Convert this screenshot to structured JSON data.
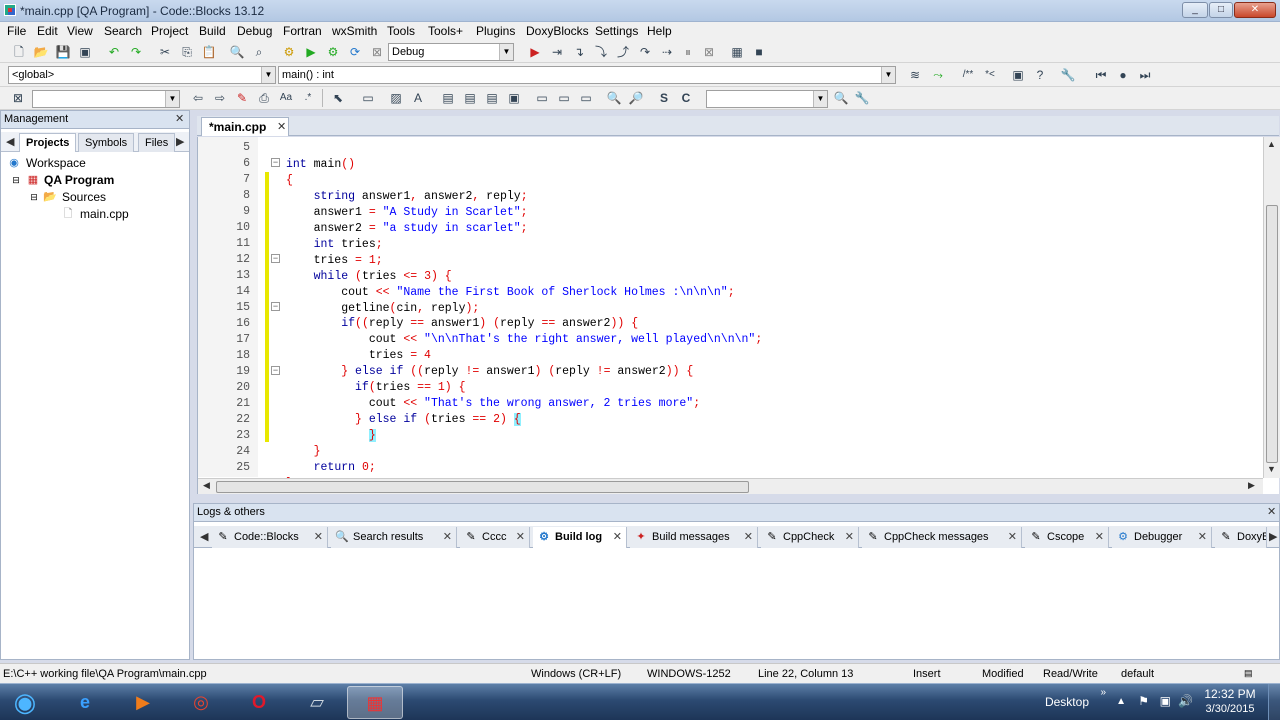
{
  "window": {
    "title": "*main.cpp [QA Program] - Code::Blocks 13.12",
    "controls": [
      "_",
      "□",
      "✕"
    ]
  },
  "menu": [
    "File",
    "Edit",
    "View",
    "Search",
    "Project",
    "Build",
    "Debug",
    "Fortran",
    "wxSmith",
    "Tools",
    "Tools+",
    "Plugins",
    "DoxyBlocks",
    "Settings",
    "Help"
  ],
  "toolbar": {
    "build_target": "Debug",
    "scope": "<global>",
    "function": "main() : int",
    "search_value": "",
    "symbol_value": ""
  },
  "management": {
    "title": "Management",
    "tabs": [
      "Projects",
      "Symbols",
      "Files"
    ],
    "tree": {
      "workspace": "Workspace",
      "project": "QA Program",
      "folder": "Sources",
      "file": "main.cpp"
    }
  },
  "editor": {
    "tab_label": "*main.cpp",
    "line_numbers": [
      "5",
      "6",
      "7",
      "8",
      "9",
      "10",
      "11",
      "12",
      "13",
      "14",
      "15",
      "16",
      "17",
      "18",
      "19",
      "20",
      "21",
      "22",
      "23",
      "24",
      "25"
    ],
    "code_lines": [
      "int main()",
      "{",
      "    string answer1, answer2, reply;",
      "    answer1 = \"A Study in Scarlet\";",
      "    answer2 = \"a study in scarlet\";",
      "    int tries;",
      "    tries = 1;",
      "    while (tries <= 3) {",
      "        cout << \"Name the First Book of Sherlock Holmes :\\n\\n\\n\";",
      "        getline(cin, reply);",
      "        if((reply == answer1) (reply == answer2)) {",
      "            cout << \"\\n\\nThat's the right answer, well played\\n\\n\\n\";",
      "            tries = 4",
      "        } else if ((reply != answer1) (reply != answer2)) {",
      "          if(tries == 1) {",
      "            cout << \"That's the wrong answer, 2 tries more\";",
      "          } else if (tries == 2) {",
      "            }",
      "    }",
      "    return 0;",
      "}"
    ]
  },
  "logs": {
    "title": "Logs & others",
    "tabs": [
      "Code::Blocks",
      "Search results",
      "Cccc",
      "Build log",
      "Build messages",
      "CppCheck",
      "CppCheck messages",
      "Cscope",
      "Debugger",
      "DoxyB"
    ],
    "active_tab": "Build log"
  },
  "status": {
    "path": "E:\\C++ working file\\QA Program\\main.cpp",
    "eol": "Windows (CR+LF)",
    "encoding": "WINDOWS-1252",
    "position": "Line 22, Column 13",
    "mode": "Insert",
    "modified": "Modified",
    "access": "Read/Write",
    "profile": "default"
  },
  "taskbar": {
    "desktop_label": "Desktop",
    "time": "12:32 PM",
    "date": "3/30/2015"
  },
  "colors": {
    "keyword": "#00009c",
    "string": "#0000ff",
    "operator": "#e00000",
    "change_bar": "#e8e800",
    "brace_highlight": "#8ff0ff"
  }
}
